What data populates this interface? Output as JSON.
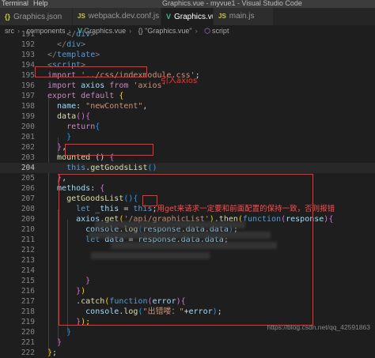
{
  "menubar": {
    "items": [
      "Terminal",
      "Help"
    ],
    "window_title": "Graphics.vue - myvue1 - Visual Studio Code"
  },
  "tabs": [
    {
      "icon": "{}",
      "icon_name": "json-file-icon",
      "label": "Graphics.json",
      "active": false
    },
    {
      "icon": "JS",
      "icon_name": "js-file-icon",
      "label": "webpack.dev.conf.js",
      "active": false
    },
    {
      "icon": "V",
      "icon_name": "vue-file-icon",
      "label": "Graphics.vue",
      "active": true
    },
    {
      "icon": "JS",
      "icon_name": "js-file-icon",
      "label": "main.js",
      "active": false
    }
  ],
  "breadcrumb": [
    "src",
    "components",
    "Graphics.vue",
    "{} \"Graphics.vue\"",
    "script"
  ],
  "code_lines": [
    {
      "n": "191",
      "tokens": [
        [
          "    ",
          "plain"
        ],
        [
          "</",
          "punc"
        ],
        [
          "div",
          "tag"
        ],
        [
          ">",
          "punc"
        ]
      ]
    },
    {
      "n": "192",
      "tokens": [
        [
          "  ",
          "plain"
        ],
        [
          "</",
          "punc"
        ],
        [
          "div",
          "tag"
        ],
        [
          ">",
          "punc"
        ]
      ]
    },
    {
      "n": "193",
      "tokens": [
        [
          "</",
          "punc"
        ],
        [
          "template",
          "tag"
        ],
        [
          ">",
          "punc"
        ]
      ]
    },
    {
      "n": "194",
      "tokens": [
        [
          "<",
          "punc"
        ],
        [
          "script",
          "tag"
        ],
        [
          ">",
          "punc"
        ]
      ]
    },
    {
      "n": "195",
      "tokens": [
        [
          "import",
          "ctl"
        ],
        [
          " '../css/indexmodule.css'",
          "str"
        ],
        [
          ";",
          "plain"
        ]
      ]
    },
    {
      "n": "196",
      "tokens": [
        [
          "import",
          "ctl"
        ],
        [
          " axios ",
          "prop"
        ],
        [
          "from",
          "ctl"
        ],
        [
          " 'axios'",
          "str"
        ]
      ]
    },
    {
      "n": "197",
      "tokens": [
        [
          "export",
          "ctl"
        ],
        [
          " ",
          "plain"
        ],
        [
          "default",
          "ctl"
        ],
        [
          " ",
          "plain"
        ],
        [
          "{",
          "br1"
        ]
      ]
    },
    {
      "n": "198",
      "tokens": [
        [
          "  name",
          "prop"
        ],
        [
          ": ",
          "plain"
        ],
        [
          "\"newContent\"",
          "str"
        ],
        [
          ",",
          "plain"
        ]
      ]
    },
    {
      "n": "199",
      "tokens": [
        [
          "  data",
          "fn"
        ],
        [
          "(){",
          "br2"
        ]
      ]
    },
    {
      "n": "200",
      "tokens": [
        [
          "    ",
          "plain"
        ],
        [
          "return",
          "ctl"
        ],
        [
          "{",
          "br3"
        ]
      ]
    },
    {
      "n": "201",
      "tokens": [
        [
          "    ",
          "plain"
        ],
        [
          "}",
          "br3"
        ]
      ]
    },
    {
      "n": "202",
      "tokens": [
        [
          "  ",
          "plain"
        ],
        [
          "}",
          "br2"
        ],
        [
          ",",
          "plain"
        ]
      ]
    },
    {
      "n": "203",
      "tokens": [
        [
          "  mounted",
          "fn"
        ],
        [
          " () ",
          "plain"
        ],
        [
          "{",
          "br2"
        ]
      ]
    },
    {
      "n": "204",
      "tokens": [
        [
          "    ",
          "plain"
        ],
        [
          "this",
          "kw"
        ],
        [
          ".",
          "plain"
        ],
        [
          "getGoodsList",
          "fn"
        ],
        [
          "()",
          "br3"
        ]
      ]
    },
    {
      "n": "205",
      "tokens": [
        [
          "  ",
          "plain"
        ],
        [
          "}",
          "br2"
        ],
        [
          ",",
          "plain"
        ]
      ]
    },
    {
      "n": "206",
      "tokens": [
        [
          "  methods",
          "prop"
        ],
        [
          ": ",
          "plain"
        ],
        [
          "{",
          "br2"
        ]
      ]
    },
    {
      "n": "207",
      "tokens": [
        [
          "    getGoodsList",
          "fn"
        ],
        [
          "(){",
          "br3"
        ]
      ]
    },
    {
      "n": "208",
      "tokens": [
        [
          "      ",
          "plain"
        ],
        [
          "let",
          "kw"
        ],
        [
          " _this ",
          "prop"
        ],
        [
          "= ",
          "plain"
        ],
        [
          "this",
          "kw"
        ],
        [
          ";",
          "plain"
        ],
        [
          "用get来请求一定要和前面配置的保持一致，否则报错",
          "ann"
        ]
      ]
    },
    {
      "n": "209",
      "tokens": [
        [
          "      axios",
          "prop"
        ],
        [
          ".",
          "plain"
        ],
        [
          "get",
          "fn"
        ],
        [
          "(",
          "br1"
        ],
        [
          "'/api/graphicList'",
          "str"
        ],
        [
          ")",
          "br1"
        ],
        [
          ".",
          "plain"
        ],
        [
          "then",
          "fn"
        ],
        [
          "(",
          "br1"
        ],
        [
          "function",
          "kw"
        ],
        [
          "(",
          "br2"
        ],
        [
          "response",
          "prop"
        ],
        [
          ")",
          "br2"
        ],
        [
          "{",
          "br2"
        ]
      ]
    },
    {
      "n": "210",
      "tokens": [
        [
          "        console",
          "prop"
        ],
        [
          ".",
          "plain"
        ],
        [
          "log",
          "fn"
        ],
        [
          "(",
          "br3"
        ],
        [
          "response",
          "prop"
        ],
        [
          ".",
          "plain"
        ],
        [
          "data",
          "prop"
        ],
        [
          ".",
          "plain"
        ],
        [
          "data",
          "prop"
        ],
        [
          ")",
          "br3"
        ],
        [
          ";",
          "plain"
        ]
      ]
    },
    {
      "n": "211",
      "tokens": [
        [
          "        ",
          "plain"
        ],
        [
          "let",
          "kw"
        ],
        [
          " data ",
          "prop"
        ],
        [
          "= ",
          "plain"
        ],
        [
          "response",
          "prop"
        ],
        [
          ".",
          "plain"
        ],
        [
          "data",
          "prop"
        ],
        [
          ".",
          "plain"
        ],
        [
          "data",
          "prop"
        ],
        [
          ";",
          "plain"
        ]
      ]
    },
    {
      "n": "212",
      "tokens": []
    },
    {
      "n": "213",
      "tokens": []
    },
    {
      "n": "214",
      "tokens": []
    },
    {
      "n": "215",
      "tokens": [
        [
          "        ",
          "plain"
        ],
        [
          "}",
          "br2"
        ]
      ]
    },
    {
      "n": "216",
      "tokens": [
        [
          "      ",
          "plain"
        ],
        [
          "}",
          "br2"
        ],
        [
          ")",
          "br1"
        ]
      ]
    },
    {
      "n": "217",
      "tokens": [
        [
          "      .",
          "plain"
        ],
        [
          "catch",
          "fn"
        ],
        [
          "(",
          "br1"
        ],
        [
          "function",
          "kw"
        ],
        [
          "(",
          "br2"
        ],
        [
          "error",
          "prop"
        ],
        [
          ")",
          "br2"
        ],
        [
          "{",
          "br2"
        ]
      ]
    },
    {
      "n": "218",
      "tokens": [
        [
          "        console",
          "prop"
        ],
        [
          ".",
          "plain"
        ],
        [
          "log",
          "fn"
        ],
        [
          "(",
          "br3"
        ],
        [
          "\"出错喽：\"",
          "str"
        ],
        [
          "+",
          "plain"
        ],
        [
          "error",
          "prop"
        ],
        [
          ")",
          "br3"
        ],
        [
          ";",
          "plain"
        ]
      ]
    },
    {
      "n": "219",
      "tokens": [
        [
          "      ",
          "plain"
        ],
        [
          "}",
          "br2"
        ],
        [
          ");",
          "br1"
        ]
      ]
    },
    {
      "n": "220",
      "tokens": [
        [
          "    ",
          "plain"
        ],
        [
          "}",
          "br3"
        ]
      ]
    },
    {
      "n": "221",
      "tokens": [
        [
          "  ",
          "plain"
        ],
        [
          "}",
          "br2"
        ]
      ]
    },
    {
      "n": "222",
      "tokens": [
        [
          "}",
          "br1"
        ],
        [
          ";",
          "plain"
        ]
      ]
    }
  ],
  "current_line": "204",
  "annotations": {
    "import_callout": "引入axios"
  },
  "watermark": "https://blog.csdn.net/qq_42591863",
  "colors": {
    "annotation_red": "#ff2a2a",
    "keyword_blue": "#569cd6",
    "control_purple": "#c586c0",
    "string_orange": "#ce9178",
    "function_yellow": "#dcdcaa"
  }
}
